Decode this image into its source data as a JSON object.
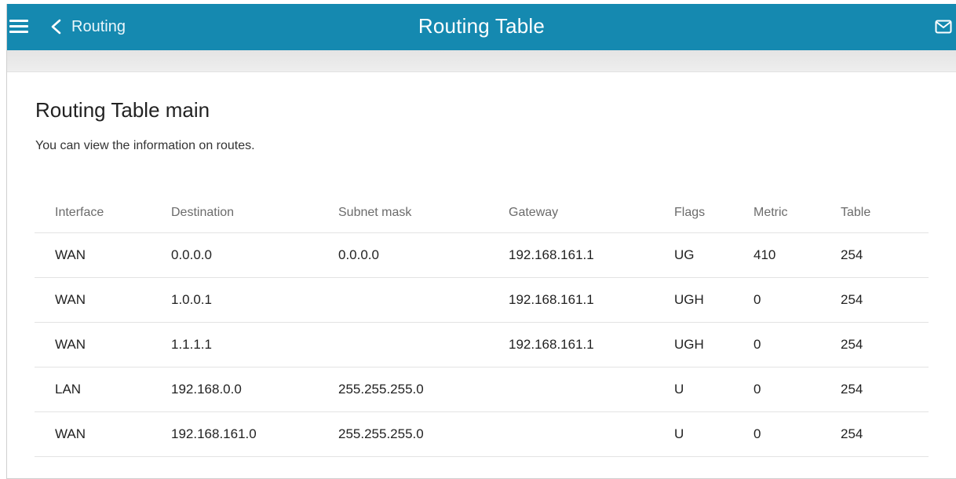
{
  "header": {
    "back_label": "Routing",
    "title": "Routing Table",
    "accent_color": "#1589b0"
  },
  "icons": {
    "menu": "hamburger-menu-icon",
    "back": "chevron-left-icon",
    "mail": "mail-icon"
  },
  "section": {
    "title": "Routing Table main",
    "description": "You can view the information on routes."
  },
  "table": {
    "columns": [
      "Interface",
      "Destination",
      "Subnet mask",
      "Gateway",
      "Flags",
      "Metric",
      "Table"
    ],
    "rows": [
      {
        "interface": "WAN",
        "destination": "0.0.0.0",
        "subnet_mask": "0.0.0.0",
        "gateway": "192.168.161.1",
        "flags": "UG",
        "metric": "410",
        "table": "254"
      },
      {
        "interface": "WAN",
        "destination": "1.0.0.1",
        "subnet_mask": "",
        "gateway": "192.168.161.1",
        "flags": "UGH",
        "metric": "0",
        "table": "254"
      },
      {
        "interface": "WAN",
        "destination": "1.1.1.1",
        "subnet_mask": "",
        "gateway": "192.168.161.1",
        "flags": "UGH",
        "metric": "0",
        "table": "254"
      },
      {
        "interface": "LAN",
        "destination": "192.168.0.0",
        "subnet_mask": "255.255.255.0",
        "gateway": "",
        "flags": "U",
        "metric": "0",
        "table": "254"
      },
      {
        "interface": "WAN",
        "destination": "192.168.161.0",
        "subnet_mask": "255.255.255.0",
        "gateway": "",
        "flags": "U",
        "metric": "0",
        "table": "254"
      }
    ]
  }
}
